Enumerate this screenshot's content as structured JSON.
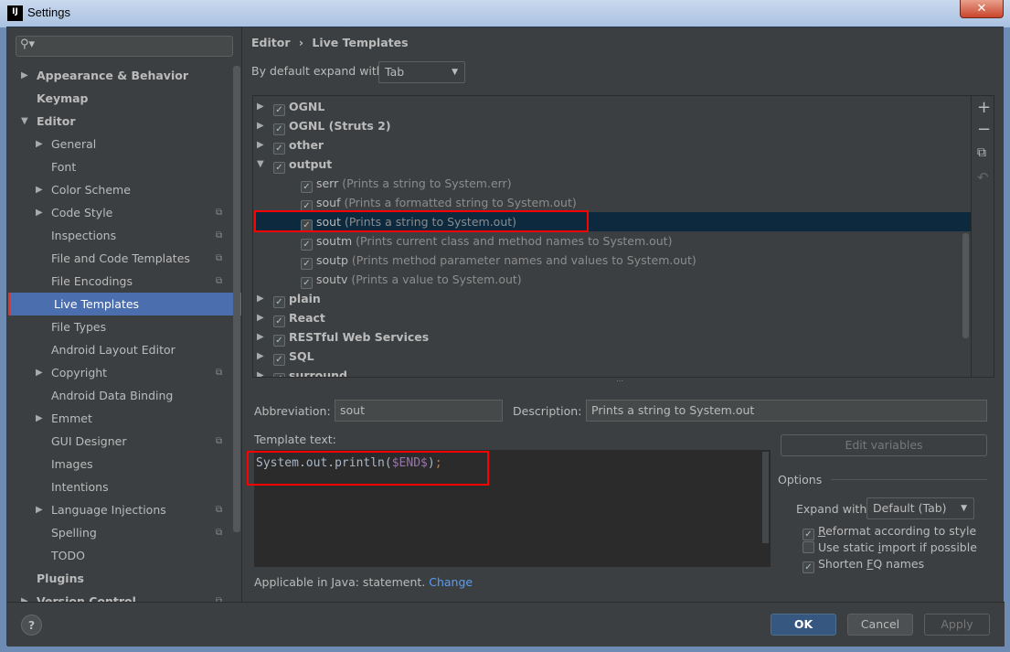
{
  "window": {
    "title": "Settings",
    "close": "✕",
    "logo": "IJ"
  },
  "sidebar": {
    "search_placeholder": "",
    "items": [
      {
        "label": "Appearance & Behavior",
        "level": 0,
        "bold": true,
        "arrow": "right"
      },
      {
        "label": "Keymap",
        "level": 0,
        "bold": true,
        "arrow": ""
      },
      {
        "label": "Editor",
        "level": 0,
        "bold": true,
        "arrow": "down"
      },
      {
        "label": "General",
        "level": 1,
        "arrow": "right"
      },
      {
        "label": "Font",
        "level": 1,
        "arrow": ""
      },
      {
        "label": "Color Scheme",
        "level": 1,
        "arrow": "right"
      },
      {
        "label": "Code Style",
        "level": 1,
        "arrow": "right",
        "project": true
      },
      {
        "label": "Inspections",
        "level": 1,
        "arrow": "",
        "project": true
      },
      {
        "label": "File and Code Templates",
        "level": 1,
        "arrow": "",
        "project": true
      },
      {
        "label": "File Encodings",
        "level": 1,
        "arrow": "",
        "project": true
      },
      {
        "label": "Live Templates",
        "level": 1,
        "arrow": "",
        "selected": true
      },
      {
        "label": "File Types",
        "level": 1,
        "arrow": ""
      },
      {
        "label": "Android Layout Editor",
        "level": 1,
        "arrow": ""
      },
      {
        "label": "Copyright",
        "level": 1,
        "arrow": "right",
        "project": true
      },
      {
        "label": "Android Data Binding",
        "level": 1,
        "arrow": ""
      },
      {
        "label": "Emmet",
        "level": 1,
        "arrow": "right"
      },
      {
        "label": "GUI Designer",
        "level": 1,
        "arrow": "",
        "project": true
      },
      {
        "label": "Images",
        "level": 1,
        "arrow": ""
      },
      {
        "label": "Intentions",
        "level": 1,
        "arrow": ""
      },
      {
        "label": "Language Injections",
        "level": 1,
        "arrow": "right",
        "project": true
      },
      {
        "label": "Spelling",
        "level": 1,
        "arrow": "",
        "project": true
      },
      {
        "label": "TODO",
        "level": 1,
        "arrow": ""
      },
      {
        "label": "Plugins",
        "level": 0,
        "bold": true,
        "arrow": ""
      },
      {
        "label": "Version Control",
        "level": 0,
        "bold": true,
        "arrow": "right",
        "project": true
      }
    ]
  },
  "breadcrumb": {
    "parent": "Editor",
    "sep": "›",
    "current": "Live Templates"
  },
  "expand_default": {
    "label": "By default expand with",
    "value": "Tab"
  },
  "tree": [
    {
      "name": "OGNL",
      "desc": "",
      "group": true,
      "arrow": "right"
    },
    {
      "name": "OGNL (Struts 2)",
      "desc": "",
      "group": true,
      "arrow": "right"
    },
    {
      "name": "other",
      "desc": "",
      "group": true,
      "arrow": "right"
    },
    {
      "name": "output",
      "desc": "",
      "group": true,
      "arrow": "down"
    },
    {
      "name": "serr",
      "desc": "(Prints a string to System.err)"
    },
    {
      "name": "souf",
      "desc": "(Prints a formatted string to System.out)"
    },
    {
      "name": "sout",
      "desc": "(Prints a string to System.out)",
      "selected": true
    },
    {
      "name": "soutm",
      "desc": "(Prints current class and method names to System.out)"
    },
    {
      "name": "soutp",
      "desc": "(Prints method parameter names and values to System.out)"
    },
    {
      "name": "soutv",
      "desc": "(Prints a value to System.out)"
    },
    {
      "name": "plain",
      "desc": "",
      "group": true,
      "arrow": "right"
    },
    {
      "name": "React",
      "desc": "",
      "group": true,
      "arrow": "right"
    },
    {
      "name": "RESTful Web Services",
      "desc": "",
      "group": true,
      "arrow": "right"
    },
    {
      "name": "SQL",
      "desc": "",
      "group": true,
      "arrow": "right"
    },
    {
      "name": "surround",
      "desc": "",
      "group": true,
      "arrow": "right"
    }
  ],
  "toolbar": {
    "add": "+",
    "remove": "−",
    "copy": "⧉",
    "restore": "↶"
  },
  "editor": {
    "abbr_label": "Abbreviation:",
    "abbr_value": "sout",
    "desc_label": "Description:",
    "desc_value": "Prints a string to System.out",
    "template_label": "Template text:",
    "code_plain": "System.out.println(",
    "code_var": "$END$",
    "code_close": ")",
    "code_semi": ";",
    "edit_vars": "Edit variables",
    "applicable": "Applicable in Java: statement.",
    "change": "Change"
  },
  "options": {
    "title": "Options",
    "expand_label": "Expand with",
    "expand_value": "Default (Tab)",
    "reformat": {
      "pre": "",
      "u": "R",
      "post": "eformat according to style",
      "checked": true
    },
    "static_import": {
      "pre": "Use static ",
      "u": "i",
      "post": "mport if possible",
      "checked": false
    },
    "shorten": {
      "pre": "Shorten ",
      "u": "F",
      "post": "Q names",
      "checked": true
    }
  },
  "buttons": {
    "help": "?",
    "ok": "OK",
    "cancel": "Cancel",
    "apply": "Apply"
  },
  "colors": {
    "accent": "#4b6eaf",
    "selection": "#0d293e",
    "highlight": "#ff0000",
    "var": "#9876aa",
    "semi": "#cc7832"
  }
}
